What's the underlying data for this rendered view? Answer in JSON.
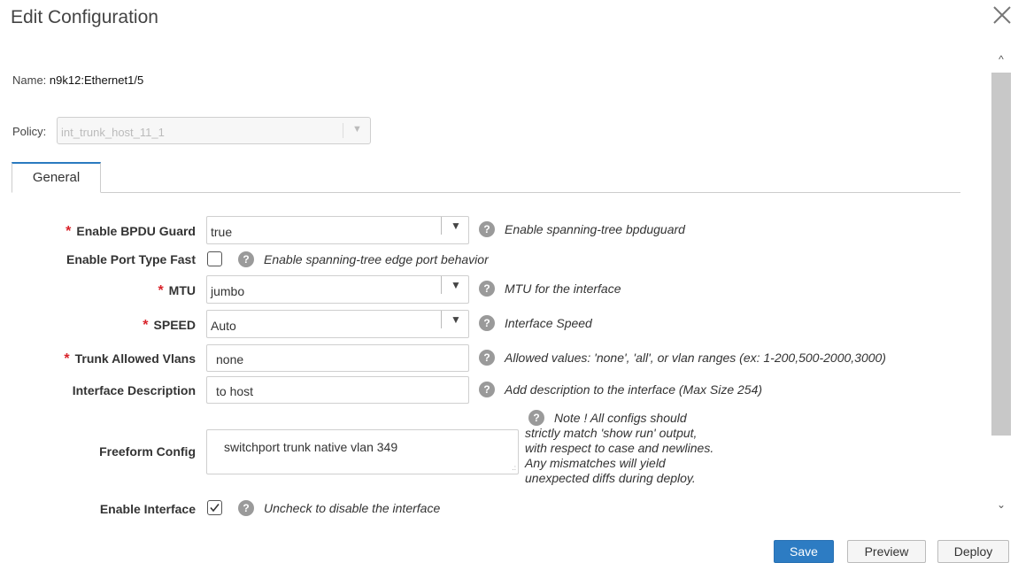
{
  "dialog": {
    "title": "Edit Configuration"
  },
  "name": {
    "label": "Name:",
    "value": "n9k12:Ethernet1/5"
  },
  "policy": {
    "label": "Policy:",
    "value": "int_trunk_host_11_1"
  },
  "tabs": [
    {
      "label": "General"
    }
  ],
  "fields": {
    "bpdu": {
      "label": "Enable BPDU Guard",
      "value": "true",
      "help": "Enable spanning-tree bpduguard",
      "required": "*"
    },
    "port_type_fast": {
      "label": "Enable Port Type Fast",
      "checked": false,
      "help": "Enable spanning-tree edge port behavior"
    },
    "mtu": {
      "label": "MTU",
      "value": "jumbo",
      "help": "MTU for the interface",
      "required": "*"
    },
    "speed": {
      "label": "SPEED",
      "value": "Auto",
      "help": "Interface Speed",
      "required": "*"
    },
    "vlans": {
      "label": "Trunk Allowed Vlans",
      "value": "none",
      "help": "Allowed values: 'none', 'all', or vlan ranges (ex: 1-200,500-2000,3000)",
      "required": "*"
    },
    "description": {
      "label": "Interface Description",
      "value": "to host",
      "help": "Add description to the interface (Max Size 254)"
    },
    "freeform": {
      "label": "Freeform Config",
      "value": "switchport trunk native vlan 349",
      "note_lines": [
        "Note ! All configs should",
        "strictly match 'show run' output,",
        "with respect to case and newlines.",
        "Any mismatches will yield",
        "unexpected diffs during deploy."
      ]
    },
    "enable_interface": {
      "label": "Enable Interface",
      "checked": true,
      "help": "Uncheck to disable the interface"
    }
  },
  "buttons": {
    "save": "Save",
    "preview": "Preview",
    "deploy": "Deploy"
  },
  "icons": {
    "close": "close-icon",
    "help": "question-circle-icon",
    "dropdown": "triangle-down-icon",
    "check": "check-icon"
  },
  "colors": {
    "primary": "#2d7cc3",
    "required": "#d9232a",
    "tab_accent": "#2a7ac0"
  }
}
